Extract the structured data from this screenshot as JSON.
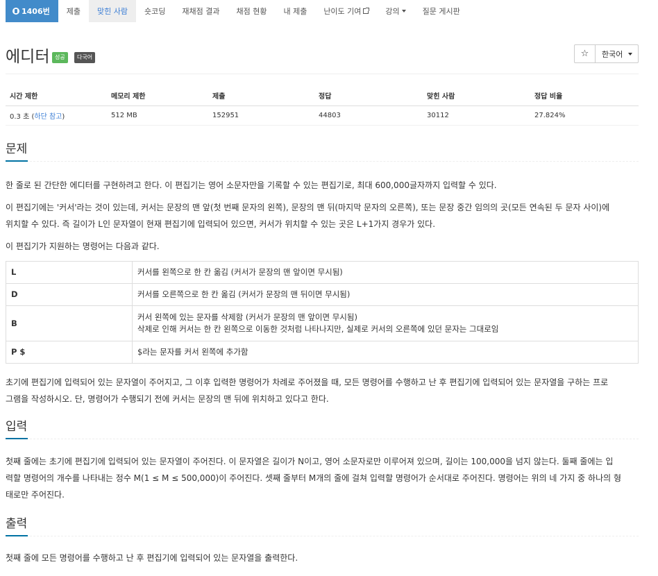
{
  "nav": {
    "problem_id": "1406번",
    "items": [
      "제출",
      "맞힌 사람",
      "숏코딩",
      "재채점 결과",
      "채점 현황",
      "내 제출",
      "난이도 기여",
      "강의",
      "질문 게시판"
    ],
    "active_index": 1
  },
  "title": {
    "text": "에디터",
    "badge_success": "성공",
    "badge_multi": "다국어",
    "star": "☆",
    "language": "한국어"
  },
  "info": {
    "headers": [
      "시간 제한",
      "메모리 제한",
      "제출",
      "정답",
      "맞힌 사람",
      "정답 비율"
    ],
    "time_limit": "0.3 초 (",
    "time_link": "하단 참고",
    "time_close": ")",
    "memory": "512 MB",
    "submissions": "152951",
    "correct": "44803",
    "solvers": "30112",
    "ratio": "27.824%"
  },
  "problem": {
    "heading": "문제",
    "p1": "한 줄로 된 간단한 에디터를 구현하려고 한다. 이 편집기는 영어 소문자만을 기록할 수 있는 편집기로, 최대 600,000글자까지 입력할 수 있다.",
    "p2a": "이 편집기에는 '커서'라는 것이 있는데, 커서는 문장의 맨 앞(첫 번째 문자의 왼쪽), 문장의 맨 뒤(마지막 문자의 오른쪽), 또는 문장 중간 임의의 곳(모든 연속된 두 문자 사이)에",
    "p2b": "위치할 수 있다. 즉 길이가 L인 문자열이 현재 편집기에 입력되어 있으면, 커서가 위치할 수 있는 곳은 L+1가지 경우가 있다.",
    "p3": "이 편집기가 지원하는 명령어는 다음과 같다.",
    "commands": [
      {
        "cmd": "L",
        "desc": "커서를 왼쪽으로 한 칸 옮김 (커서가 문장의 맨 앞이면 무시됨)",
        "desc2": ""
      },
      {
        "cmd": "D",
        "desc": "커서를 오른쪽으로 한 칸 옮김 (커서가 문장의 맨 뒤이면 무시됨)",
        "desc2": ""
      },
      {
        "cmd": "B",
        "desc": "커서 왼쪽에 있는 문자를 삭제함 (커서가 문장의 맨 앞이면 무시됨)",
        "desc2": "삭제로 인해 커서는 한 칸 왼쪽으로 이동한 것처럼 나타나지만, 실제로 커서의 오른쪽에 있던 문자는 그대로임"
      },
      {
        "cmd": "P $",
        "desc": "$라는 문자를 커서 왼쪽에 추가함",
        "desc2": ""
      }
    ],
    "p4a": "초기에 편집기에 입력되어 있는 문자열이 주어지고, 그 이후 입력한 명령어가 차례로 주어졌을 때, 모든 명령어를 수행하고 난 후 편집기에 입력되어 있는 문자열을 구하는 프로",
    "p4b": "그램을 작성하시오. 단, 명령어가 수행되기 전에 커서는 문장의 맨 뒤에 위치하고 있다고 한다."
  },
  "input": {
    "heading": "입력",
    "l1": "첫째 줄에는 초기에 편집기에 입력되어 있는 문자열이 주어진다. 이 문자열은 길이가 N이고, 영어 소문자로만 이루어져 있으며, 길이는 100,000을 넘지 않는다. 둘째 줄에는 입",
    "l2": "력할 명령어의 개수를 나타내는 정수 M(1 ≤ M ≤ 500,000)이 주어진다. 셋째 줄부터 M개의 줄에 걸쳐 입력할 명령어가 순서대로 주어진다. 명령어는 위의 네 가지 중 하나의 형",
    "l3": "태로만 주어진다."
  },
  "output": {
    "heading": "출력",
    "l1": "첫째 줄에 모든 명령어를 수행하고 난 후 편집기에 입력되어 있는 문자열을 출력한다."
  }
}
